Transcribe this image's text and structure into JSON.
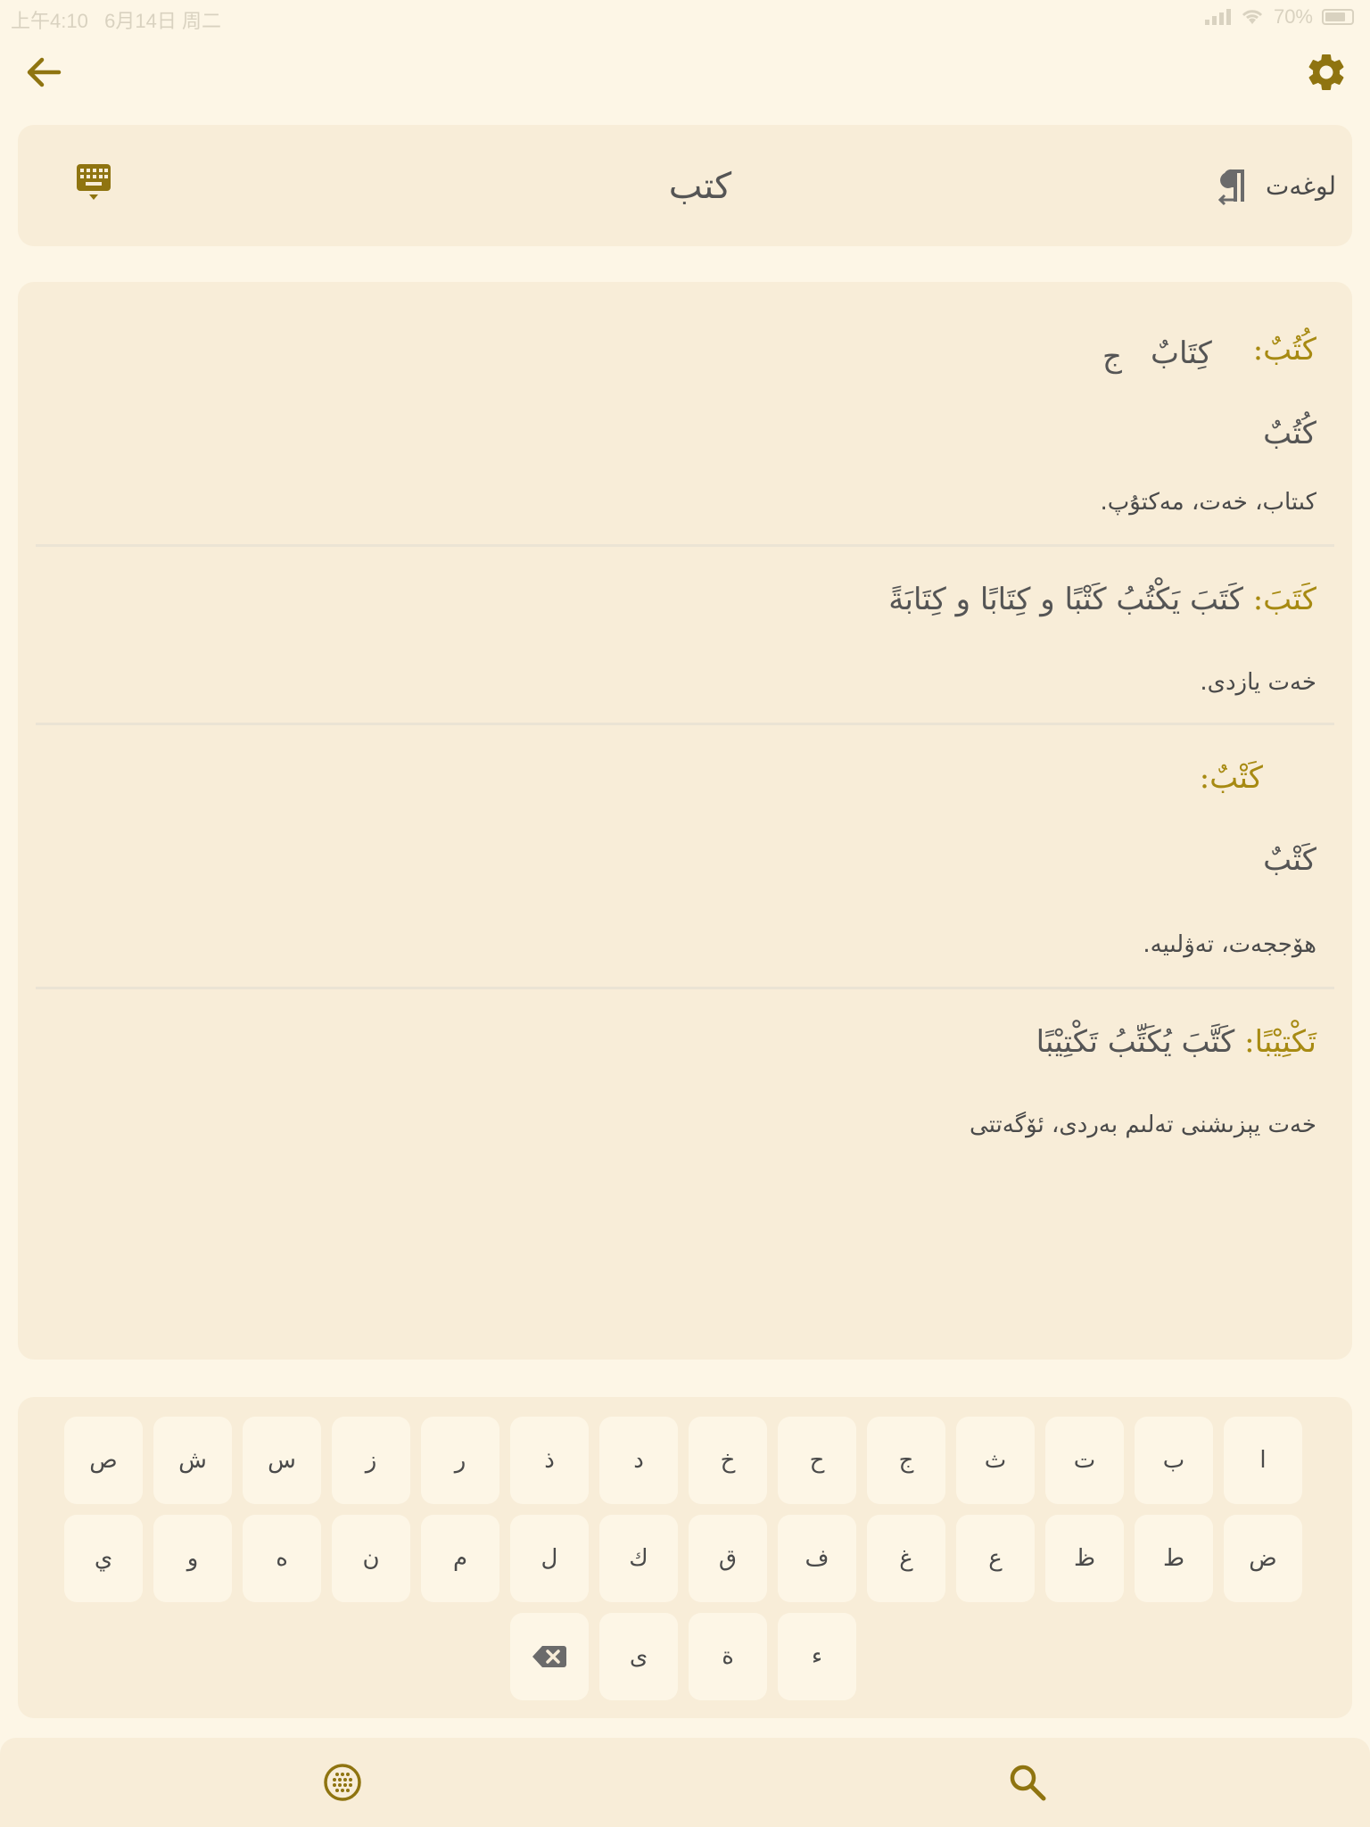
{
  "status_bar": {
    "time": "上午4:10",
    "date": "6月14日 周二",
    "battery": "70%"
  },
  "top_bar": {
    "back_icon": "arrow-left-icon",
    "settings_icon": "gear-icon"
  },
  "search": {
    "query": "كتب",
    "mode_label": "لوغەت",
    "mode_icon": "pilcrow-icon",
    "keyboard_icon": "keyboard-icon"
  },
  "entries": [
    {
      "headword": "كُتُبٌ:",
      "forms": [
        "كِتَابٌ",
        "ج"
      ],
      "plural": "كُتُبٌ",
      "gloss": "كىتاب، خەت، مەكتۇپ."
    },
    {
      "headword": "كَتَبَ:",
      "forms_line": "كَتَبَ يَكْتُبُ كَتْبًا و كِتَابًا و كِتَابَةً",
      "gloss": "خەت يازدى."
    },
    {
      "headword": "كَتْبٌ:",
      "plural": "كَتْبٌ",
      "gloss": "هۆججەت، تەۋلىيە."
    },
    {
      "headword": "تَكْتِيْبًا:",
      "forms_line": "كَتَّبَ يُكَتِّبُ تَكْتِيْبًا",
      "gloss": "خەت يېزىشنى تەلىم بەردى، ئۆگەتتى"
    }
  ],
  "keyboard": {
    "row1": [
      "ا",
      "ب",
      "ت",
      "ث",
      "ج",
      "ح",
      "خ",
      "د",
      "ذ",
      "ر",
      "ز",
      "س",
      "ش",
      "ص"
    ],
    "row2": [
      "ض",
      "ط",
      "ظ",
      "ع",
      "غ",
      "ف",
      "ق",
      "ك",
      "ل",
      "م",
      "ن",
      "ه",
      "و",
      "ي"
    ],
    "row3": [
      "ء",
      "ة",
      "ى"
    ],
    "backspace_icon": "backspace-icon"
  },
  "bottom_bar": {
    "left_icon": "grid-icon",
    "right_icon": "search-icon"
  },
  "colors": {
    "background": "#fdf6e6",
    "card": "#f8edd8",
    "accent": "#8f7410",
    "headword": "#a78a12"
  }
}
